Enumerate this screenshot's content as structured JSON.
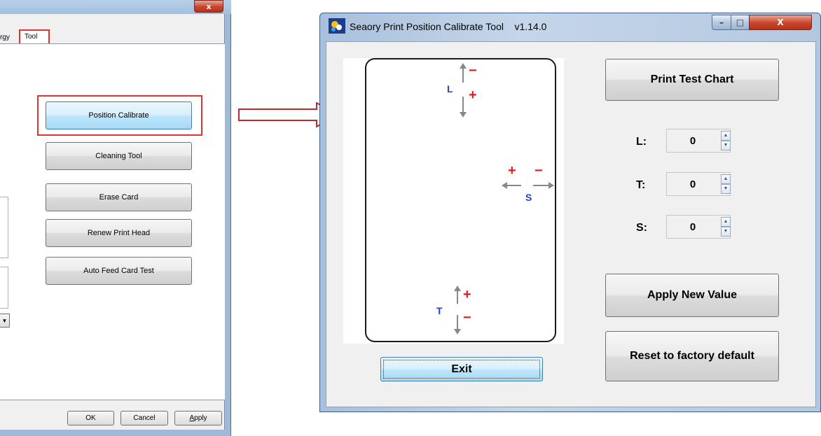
{
  "left_window": {
    "close_glyph": "x",
    "tabs": {
      "prev_label": "rgy",
      "tool_label": "Tool"
    },
    "buttons": {
      "position_calibrate": "Position Calibrate",
      "cleaning_tool": "Cleaning Tool",
      "erase_card": "Erase Card",
      "renew_print_head": "Renew Print Head",
      "auto_feed_card_test": "Auto Feed Card Test"
    },
    "footer": {
      "ok": "OK",
      "cancel": "Cancel",
      "apply_first": "A",
      "apply_rest": "pply"
    }
  },
  "right_window": {
    "title": "Seaory Print Position Calibrate Tool    v1.14.0",
    "caption": {
      "minimize": "–",
      "maximize": "□",
      "close": "X"
    },
    "card_labels": {
      "l": "L",
      "t": "T",
      "s": "S",
      "plus": "+",
      "minus": "−"
    },
    "buttons": {
      "print_test_chart": "Print Test Chart",
      "apply_new_value": "Apply New Value",
      "reset_default": "Reset to factory default",
      "exit": "Exit"
    },
    "fields": [
      {
        "label": "L:",
        "value": "0"
      },
      {
        "label": "T:",
        "value": "0"
      },
      {
        "label": "S:",
        "value": "0"
      }
    ]
  },
  "colors": {
    "highlight": "#e0332f",
    "label_blue": "#1f3fd6",
    "sign_red": "#e01c1c"
  }
}
